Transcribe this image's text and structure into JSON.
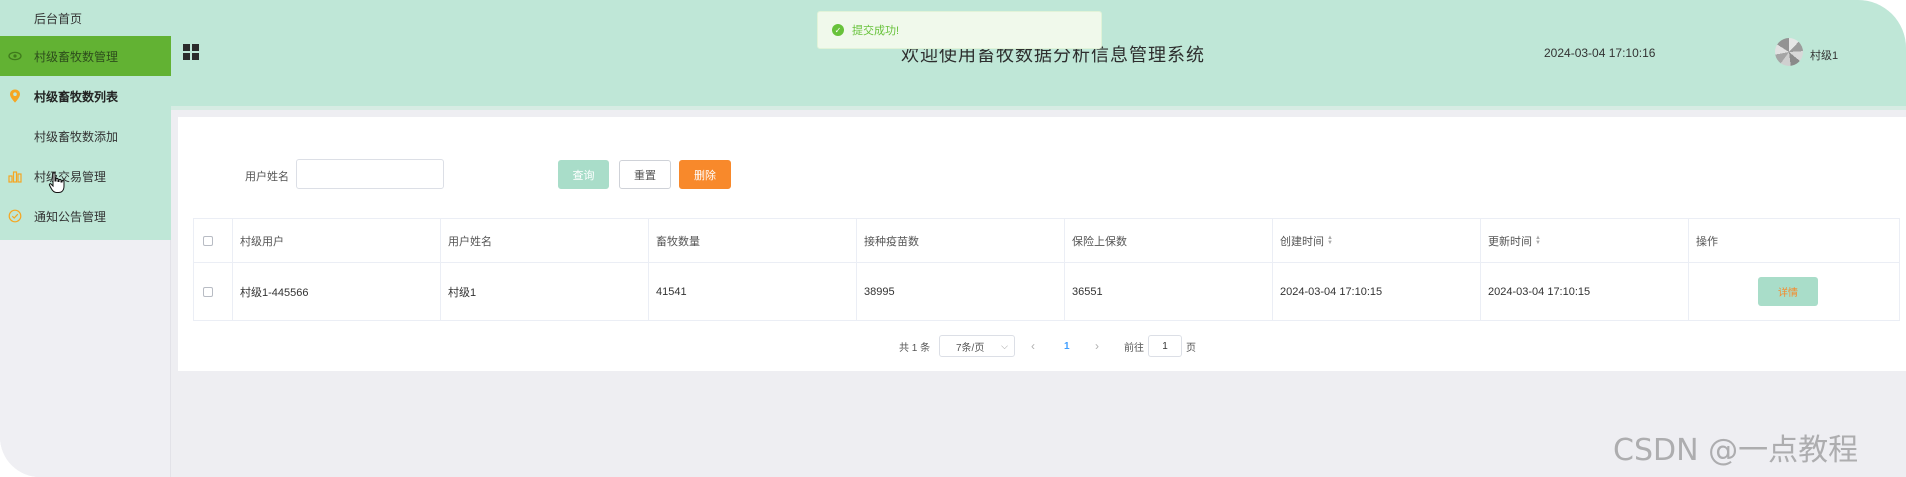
{
  "sidebar": {
    "items": [
      {
        "label": "后台首页"
      },
      {
        "label": "村级畜牧数管理"
      },
      {
        "label": "村级畜牧数列表"
      },
      {
        "label": "村级畜牧数添加"
      },
      {
        "label": "村级交易管理"
      },
      {
        "label": "通知公告管理"
      }
    ],
    "colors": {
      "menu_bg": "#bfe7d7",
      "active_bg": "#62b233",
      "icon_accent": "#f5a623"
    }
  },
  "header": {
    "title": "欢迎使用畜牧数据分析信息管理系统",
    "datetime": "2024-03-04 17:10:16",
    "username": "村级1"
  },
  "toast": {
    "message": "提交成功!"
  },
  "search": {
    "label": "用户姓名",
    "value": "",
    "placeholder": "",
    "query_label": "查询",
    "reset_label": "重置",
    "delete_label": "删除"
  },
  "table": {
    "columns": [
      "村级用户",
      "用户姓名",
      "畜牧数量",
      "接种疫苗数",
      "保险上保数",
      "创建时间",
      "更新时间",
      "操作"
    ],
    "rows": [
      {
        "cells": [
          "村级1-445566",
          "村级1",
          "41541",
          "38995",
          "36551",
          "2024-03-04 17:10:15",
          "2024-03-04 17:10:15"
        ],
        "action_label": "详情"
      }
    ]
  },
  "pagination": {
    "total": "共 1 条",
    "page_size": "7条/页",
    "current_page": "1",
    "goto_label": "前往",
    "goto_value": "1",
    "page_suffix": "页"
  },
  "watermark": "CSDN @一点教程",
  "icons": {
    "sidebar": [
      "eye-icon",
      "location-icon",
      "bar-chart-icon",
      "check-circle-icon"
    ],
    "header": [
      "grid-menu-icon",
      "avatar"
    ],
    "toast": "success-icon"
  }
}
